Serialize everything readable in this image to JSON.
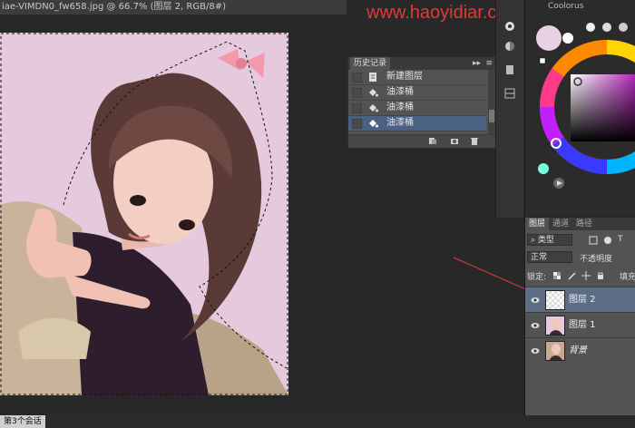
{
  "document": {
    "tab_title": "iae-VIMDN0_fw658.jpg @ 66.7% (图层 2, RGB/8#)",
    "status": "第3个会话"
  },
  "watermark": "www.haoyidiar.com",
  "history": {
    "title": "历史记录",
    "items": [
      {
        "label": "新建图层",
        "icon": "new-layer-icon",
        "active": false
      },
      {
        "label": "油漆桶",
        "icon": "paint-bucket-icon",
        "active": false
      },
      {
        "label": "油漆桶",
        "icon": "paint-bucket-icon",
        "active": false
      },
      {
        "label": "油漆桶",
        "icon": "paint-bucket-icon",
        "active": true
      }
    ]
  },
  "coolorus": {
    "title": "Coolorus"
  },
  "layers_panel": {
    "tabs": [
      {
        "label": "图层",
        "active": true
      },
      {
        "label": "通道",
        "active": false
      },
      {
        "label": "路径",
        "active": false
      }
    ],
    "filter_kind": "类型",
    "blend_mode": "正常",
    "opacity_label": "不透明度",
    "lock_label": "锁定:",
    "fill_label": "填充",
    "layers": [
      {
        "name": "图层 2",
        "active": true,
        "thumb": "transparent"
      },
      {
        "name": "图层 1",
        "active": false,
        "thumb": "photo"
      },
      {
        "name": "背景",
        "active": false,
        "thumb": "photo"
      }
    ]
  },
  "colors": {
    "canvas_background": "#e5c9dc",
    "active_row": "#4b6183",
    "watermark": "#e23a3a",
    "annotation_arrow": "#d23a3a"
  }
}
